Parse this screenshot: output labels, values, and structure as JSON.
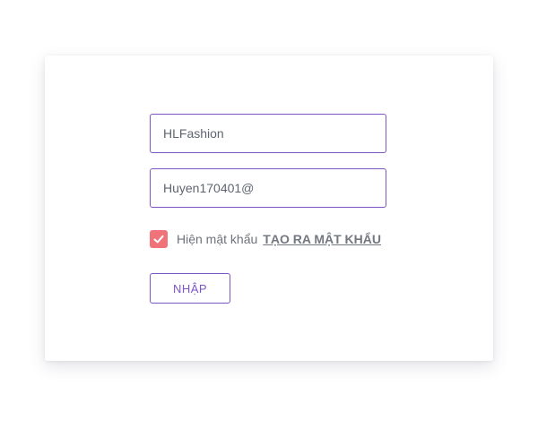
{
  "form": {
    "username": {
      "value": "HLFashion",
      "placeholder": ""
    },
    "password": {
      "value": "Huyen170401@",
      "placeholder": ""
    },
    "show_password": {
      "label": "Hiện mật khẩu",
      "checked": true,
      "icon": "check-icon"
    },
    "create_password_link": "TẠO RA MẬT KHẨU",
    "submit_label": "NHẬP"
  },
  "colors": {
    "accent": "#7b56c4",
    "checkbox": "#f0737a",
    "text": "#6e737c"
  }
}
